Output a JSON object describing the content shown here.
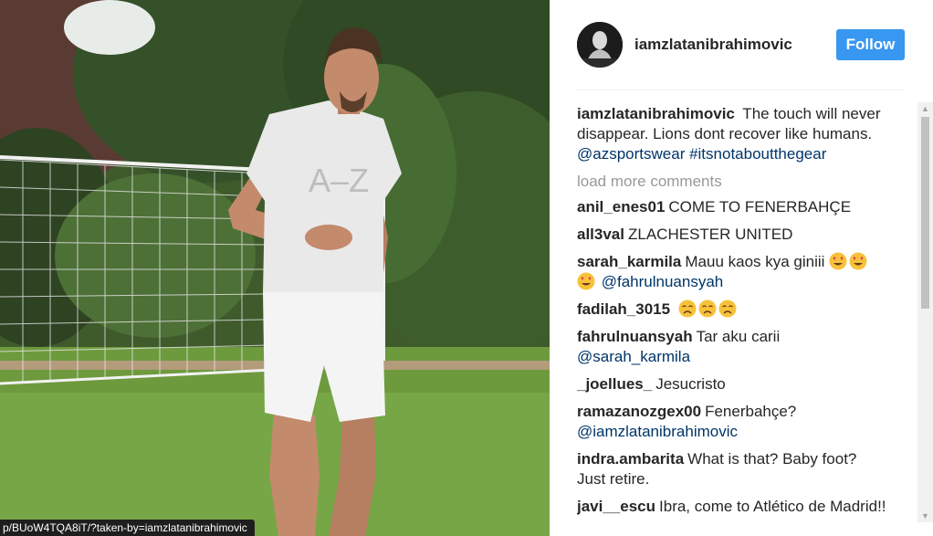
{
  "post": {
    "username": "iamzlatanibrahimovic",
    "follow_label": "Follow",
    "caption": {
      "user": "iamzlatanibrahimovic",
      "text": " The touch will never disappear. Lions dont recover like humans.",
      "tags": "@azsportswear #itsnotaboutthegear"
    },
    "shirt_text": "A–Z",
    "load_more": "load more comments",
    "comments": [
      {
        "user": "anil_enes01",
        "text": "COME TO FENERBAHÇE"
      },
      {
        "user": "all3val",
        "text": "ZLACHESTER UNITED"
      },
      {
        "user": "sarah_karmila",
        "text": "Mauu kaos kya giniii",
        "mention": "@fahrulnuansyah"
      },
      {
        "user": "fadilah_3015",
        "text": ""
      },
      {
        "user": "fahrulnuansyah",
        "text": "Tar aku carii",
        "mention": "@sarah_karmila"
      },
      {
        "user": "_joellues_",
        "text": "Jesucristo"
      },
      {
        "user": "ramazanozgex00",
        "text": "Fenerbahçe?",
        "mention": "@iamzlatanibrahimovic"
      },
      {
        "user": "indra.ambarita",
        "text": "What is that? Baby foot? Just retire."
      },
      {
        "user": "javi__escu",
        "text": "Ibra, come to Atlético de Madrid!!"
      }
    ]
  },
  "status_bar": {
    "url": "p/BUoW4TQA8iT/?taken-by=iamzlatanibrahimovic"
  },
  "icons": {
    "heart_eyes": "heart-eyes-emoji",
    "sad": "disappointed-emoji"
  },
  "colors": {
    "follow_button": "#3897f0",
    "link": "#003569",
    "muted": "#999999"
  }
}
